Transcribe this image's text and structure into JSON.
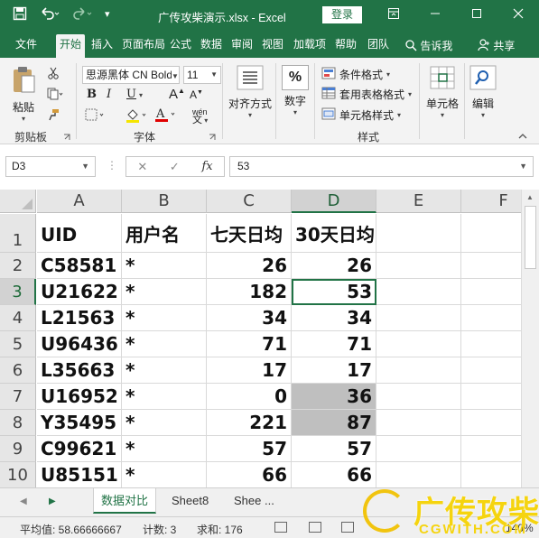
{
  "titlebar": {
    "save_icon": "save-icon",
    "undo_icon": "undo-icon",
    "redo_icon": "redo-icon",
    "customize_icon": "customize-qat-icon",
    "title": "广传攻柴演示.xlsx  -  Excel",
    "login": "登录",
    "ribbon_display_icon": "ribbon-display-icon",
    "minimize_icon": "minimize-icon",
    "maximize_icon": "maximize-icon",
    "close_icon": "close-icon"
  },
  "tabs": {
    "file": "文件",
    "home": "开始",
    "insert": "插入",
    "page_layout": "页面布局",
    "formulas": "公式",
    "data": "数据",
    "review": "审阅",
    "view": "视图",
    "addins": "加载项",
    "help": "帮助",
    "team": "团队",
    "tell_me": "告诉我",
    "share": "共享"
  },
  "ribbon": {
    "clipboard": {
      "paste": "粘贴",
      "group": "剪贴板"
    },
    "font": {
      "name": "思源黑体 CN Bold",
      "size": "11",
      "bold": "B",
      "italic": "I",
      "underline": "U",
      "grow": "A",
      "shrink": "A",
      "wen": "wén",
      "group": "字体"
    },
    "alignment": {
      "label": "对齐方式"
    },
    "number": {
      "label": "数字",
      "symbol": "%"
    },
    "styles": {
      "conditional": "条件格式",
      "table": "套用表格格式",
      "cell": "单元格样式",
      "group": "样式"
    },
    "cells": {
      "label": "单元格"
    },
    "editing": {
      "label": "编辑"
    }
  },
  "formula_bar": {
    "name_box": "D3",
    "cancel": "✕",
    "enter": "✓",
    "fx": "fx",
    "value": "53"
  },
  "columns": [
    "A",
    "B",
    "C",
    "D",
    "E",
    "F"
  ],
  "rows": [
    "1",
    "2",
    "3",
    "4",
    "5",
    "6",
    "7",
    "8",
    "9",
    "10"
  ],
  "table": {
    "headers": [
      "UID",
      "用户名",
      "七天日均",
      "30天日均"
    ],
    "rows": [
      [
        "C58581",
        "*",
        "26",
        "26"
      ],
      [
        "U21622",
        "*",
        "182",
        "53"
      ],
      [
        "L21563",
        "*",
        "34",
        "34"
      ],
      [
        "U96436",
        "*",
        "71",
        "71"
      ],
      [
        "L35663",
        "*",
        "17",
        "17"
      ],
      [
        "U16952",
        "*",
        "0",
        "36"
      ],
      [
        "Y35495",
        "*",
        "221",
        "87"
      ],
      [
        "C99621",
        "*",
        "57",
        "57"
      ],
      [
        "U85151",
        "*",
        "66",
        "66"
      ]
    ]
  },
  "sheets": {
    "active": "数据对比",
    "sheet8": "Sheet8",
    "more": "Shee ..."
  },
  "status": {
    "average": "平均值: 58.66666667",
    "count": "计数: 3",
    "sum": "求和: 176",
    "zoom": "140%"
  },
  "watermark": {
    "big": "广传攻柴",
    "small": "CGWITH.COM"
  }
}
